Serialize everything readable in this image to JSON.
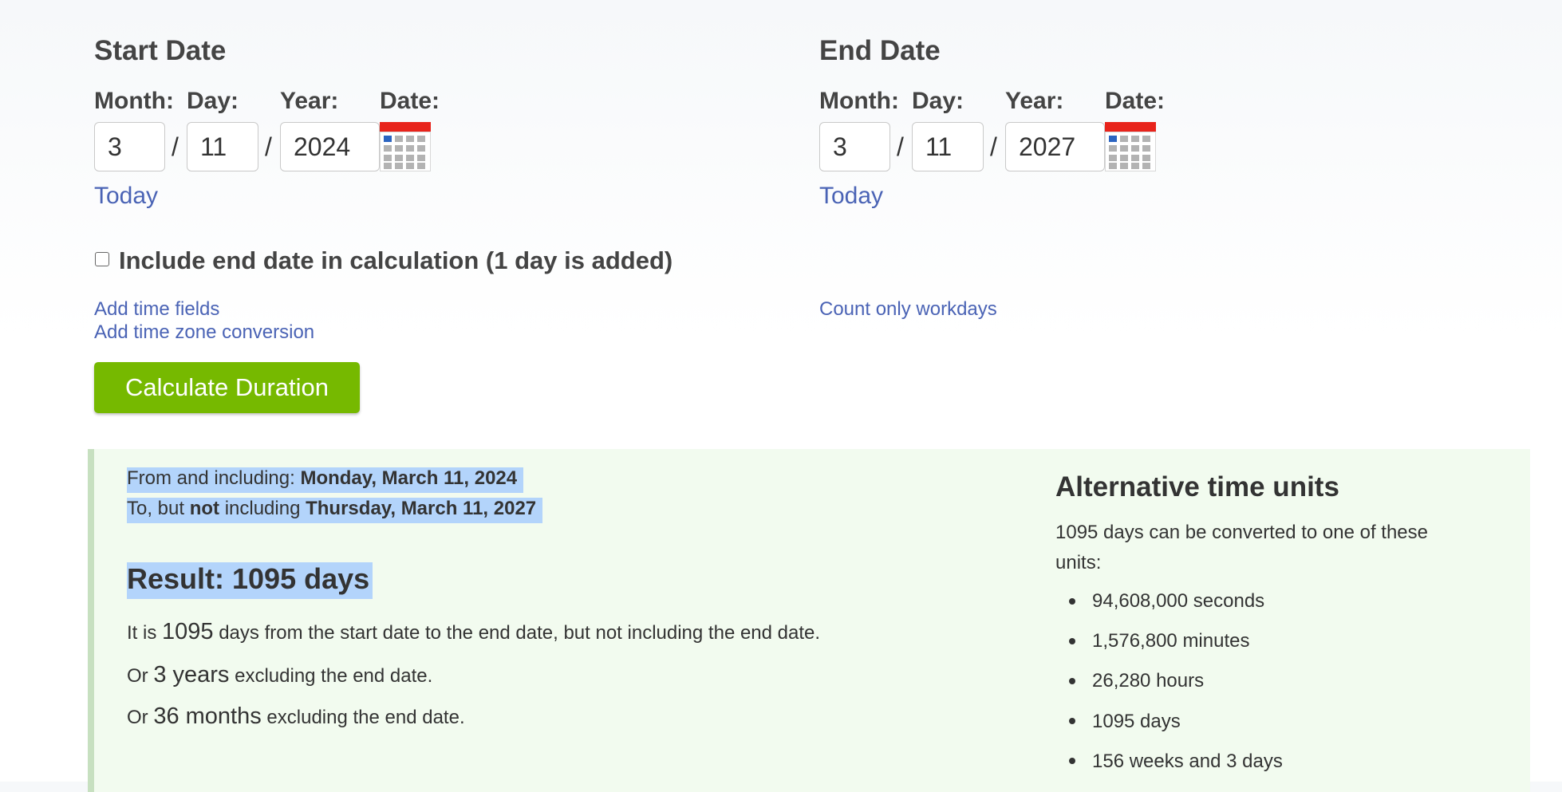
{
  "start": {
    "title": "Start Date",
    "month_label": "Month:",
    "day_label": "Day:",
    "year_label": "Year:",
    "date_label": "Date:",
    "month": "3",
    "day": "11",
    "year": "2024",
    "today_link": "Today"
  },
  "end": {
    "title": "End Date",
    "month_label": "Month:",
    "day_label": "Day:",
    "year_label": "Year:",
    "date_label": "Date:",
    "month": "3",
    "day": "11",
    "year": "2027",
    "today_link": "Today"
  },
  "separator": "/",
  "options": {
    "include_end_label": "Include end date in calculation (1 day is added)",
    "include_end_checked": false,
    "add_time_fields": "Add time fields",
    "add_time_zone": "Add time zone conversion",
    "count_workdays": "Count only workdays"
  },
  "calculate_button": "Calculate Duration",
  "result": {
    "from_prefix": "From and including: ",
    "from_date": "Monday, March 11, 2024",
    "to_prefix": "To, but ",
    "to_not": "not",
    "to_middle": " including ",
    "to_date": "Thursday, March 11, 2027",
    "title": "Result: 1095 days",
    "line1_a": "It is ",
    "line1_num": "1095",
    "line1_b": " days from the start date to the end date, but not including the end date.",
    "line2_a": "Or ",
    "line2_num": "3 years",
    "line2_b": " excluding the end date.",
    "line3_a": "Or ",
    "line3_num": "36 months",
    "line3_b": " excluding the end date."
  },
  "alternative": {
    "title": "Alternative time units",
    "desc": "1095 days can be converted to one of these units:",
    "units": [
      "94,608,000 seconds",
      "1,576,800 minutes",
      "26,280 hours",
      "1095 days",
      "156 weeks and 3 days"
    ]
  },
  "colors": {
    "accent_green": "#76b900",
    "link_blue": "#4a63b5",
    "result_bg": "#f2fbef",
    "highlight": "#b3d4fb",
    "calendar_red": "#e8231b"
  }
}
